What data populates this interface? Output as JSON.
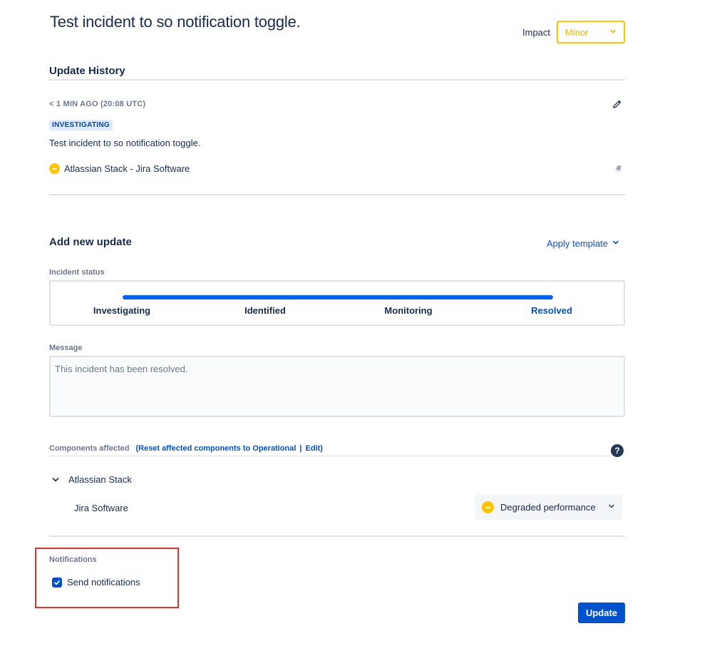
{
  "header": {
    "title": "Test incident to so notification toggle.",
    "impact_label": "Impact",
    "impact_value": "Minor"
  },
  "update_history": {
    "title": "Update History",
    "entries": [
      {
        "timestamp": "< 1 MIN AGO (20:08 UTC)",
        "status": "INVESTIGATING",
        "message": "Test incident to so notification toggle.",
        "component": "Atlassian Stack - Jira Software",
        "component_status_icon": "minor-status-icon"
      }
    ]
  },
  "new_update": {
    "title": "Add new update",
    "apply_template_label": "Apply template",
    "incident_status_label": "Incident status",
    "statuses": [
      "Investigating",
      "Identified",
      "Monitoring",
      "Resolved"
    ],
    "selected_status": "Resolved",
    "message_label": "Message",
    "message_value": "This incident has been resolved."
  },
  "components": {
    "label": "Components affected",
    "reset_link": "(Reset affected components to Operational",
    "separator": "|",
    "edit_link": "Edit)",
    "group_name": "Atlassian Stack",
    "items": [
      {
        "name": "Jira Software",
        "status": "Degraded performance"
      }
    ]
  },
  "notifications": {
    "label": "Notifications",
    "send_label": "Send notifications",
    "checked": true
  },
  "actions": {
    "update_label": "Update"
  },
  "colors": {
    "accent": "#0052cc",
    "progress": "#0065ff",
    "minor": "#ffc400",
    "highlight": "#e0322b"
  }
}
